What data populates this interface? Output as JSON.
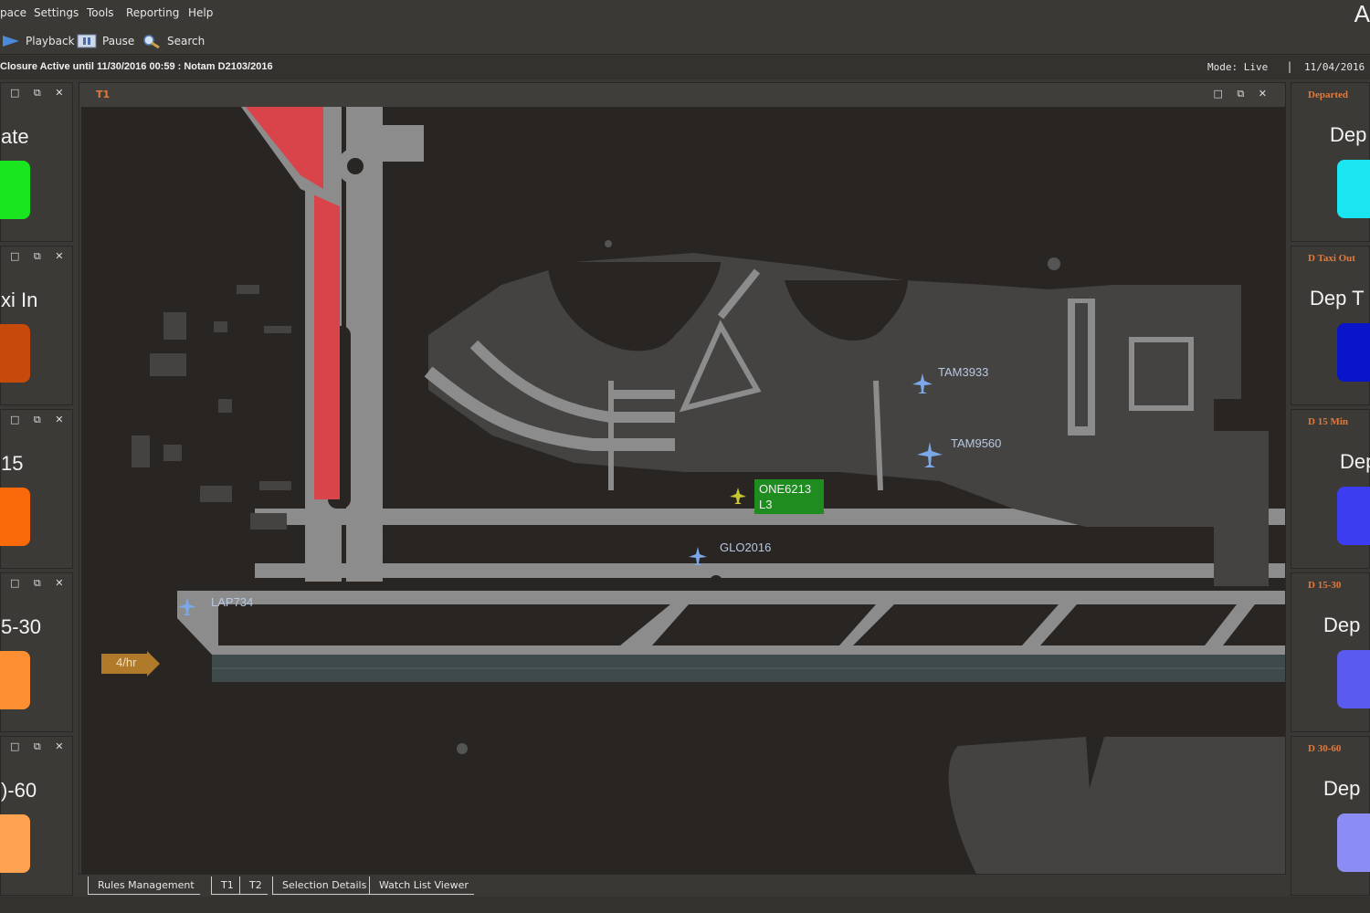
{
  "menu": {
    "items": [
      "pace",
      "Settings",
      "Tools",
      "Reporting",
      "Help"
    ],
    "app_letter": "A"
  },
  "toolbar": {
    "playback_label": "Playback",
    "pause_label": "Pause",
    "search_label": "Search"
  },
  "status": {
    "notice": "Closure Active until 11/30/2016 00:59 : Notam D2103/2016",
    "mode": "Mode: Live",
    "separator": "|",
    "date": "11/04/2016"
  },
  "left_panels": [
    {
      "label": "ate",
      "color": "#19e61e"
    },
    {
      "label": "xi In",
      "color": "#c84a0a"
    },
    {
      "label": "15",
      "color": "#fa6a0a"
    },
    {
      "label": "5-30",
      "color": "#fb8f32"
    },
    {
      "label": ")-60",
      "color": "#fca250"
    }
  ],
  "left_panel_controls": "□ ⧉ ✕",
  "right_panels": [
    {
      "header": "Departed",
      "label": "Dep",
      "color": "#19e6f0"
    },
    {
      "header": "D Taxi Out",
      "label": "Dep T",
      "color": "#0a14c8"
    },
    {
      "header": "D 15 Min",
      "label": "Dep",
      "color": "#3c3cf0"
    },
    {
      "header": "D 15-30",
      "label": "Dep",
      "color": "#5a5af0"
    },
    {
      "header": "D 30-60",
      "label": "Dep",
      "color": "#8c8cf5"
    }
  ],
  "map_window": {
    "tab_name": "T1",
    "controls": "□ ⧉ ✕",
    "rate_label": "4/hr",
    "flights": [
      {
        "callsign": "TAM3933",
        "color": "#7aa8e8"
      },
      {
        "callsign": "TAM9560",
        "color": "#7aa8e8"
      },
      {
        "callsign": "GLO2016",
        "color": "#7aa8e8"
      },
      {
        "callsign": "LAP734",
        "color": "#7aa8e8"
      }
    ],
    "selected_flight": {
      "callsign": "ONE6213",
      "sub": "L3",
      "color": "#1e8c1e"
    }
  },
  "bottom_tabs": [
    "Rules Management",
    "T1",
    "T2",
    "Selection Details",
    "Watch List Viewer"
  ],
  "colors": {
    "closure": "#d9434a",
    "taxiway": "#8c8c8c",
    "terminal": "#444342",
    "accent": "#e07a3c"
  }
}
